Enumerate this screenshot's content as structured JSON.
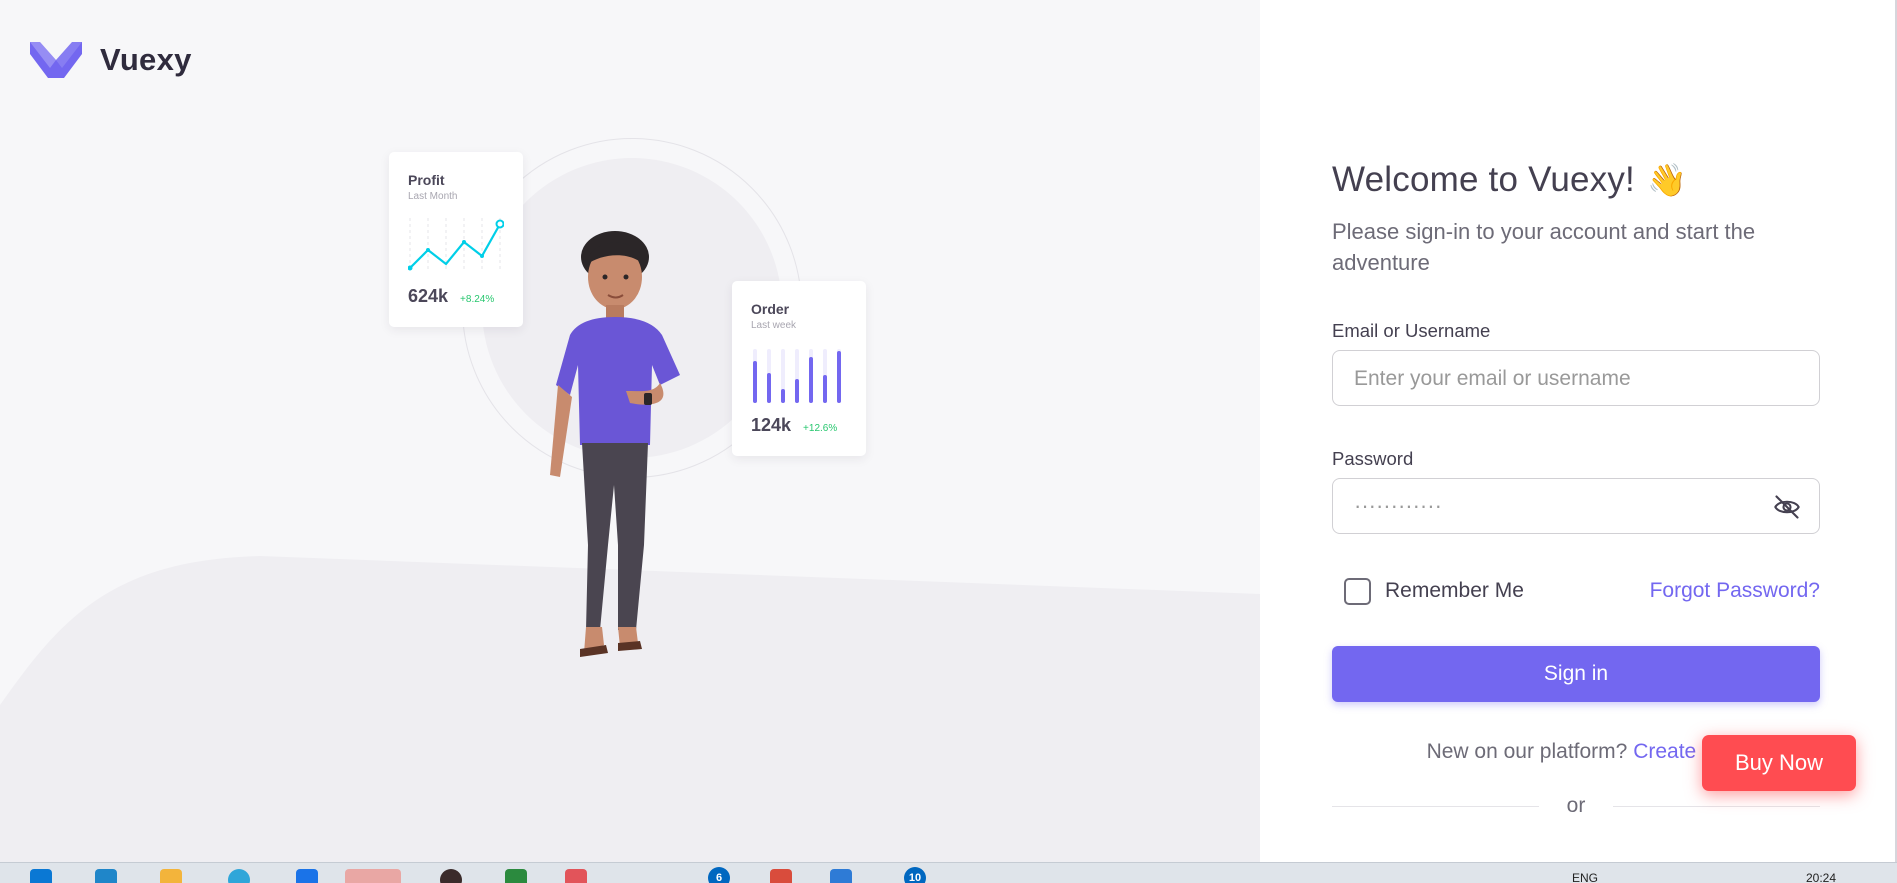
{
  "brand": {
    "name": "Vuexy",
    "color": "#7367f0"
  },
  "illustration": {
    "profit_card": {
      "title": "Profit",
      "subtitle": "Last Month",
      "value": "624k",
      "change": "+8.24%"
    },
    "order_card": {
      "title": "Order",
      "subtitle": "Last week",
      "value": "124k",
      "change": "+12.6%"
    }
  },
  "login": {
    "title": "Welcome to Vuexy!",
    "title_emoji": "👋",
    "subtitle": "Please sign-in to your account and start the adventure",
    "email_label": "Email or Username",
    "email_placeholder": "Enter your email or username",
    "email_value": "",
    "password_label": "Password",
    "password_value": "············",
    "remember_label": "Remember Me",
    "remember_checked": false,
    "forgot_label": "Forgot Password?",
    "signin_label": "Sign in",
    "new_prompt": "New on our platform?",
    "create_label": "Create an",
    "or_label": "or"
  },
  "buy_now": {
    "label": "Buy Now",
    "color": "#ff4c51"
  },
  "taskbar": {
    "badge_1": "6",
    "badge_2": "10",
    "lang": "ENG",
    "time": "20:24"
  },
  "colors": {
    "primary": "#7367f0",
    "success": "#28c76f",
    "danger": "#ff4c51",
    "panel_bg": "#f7f7f9"
  }
}
